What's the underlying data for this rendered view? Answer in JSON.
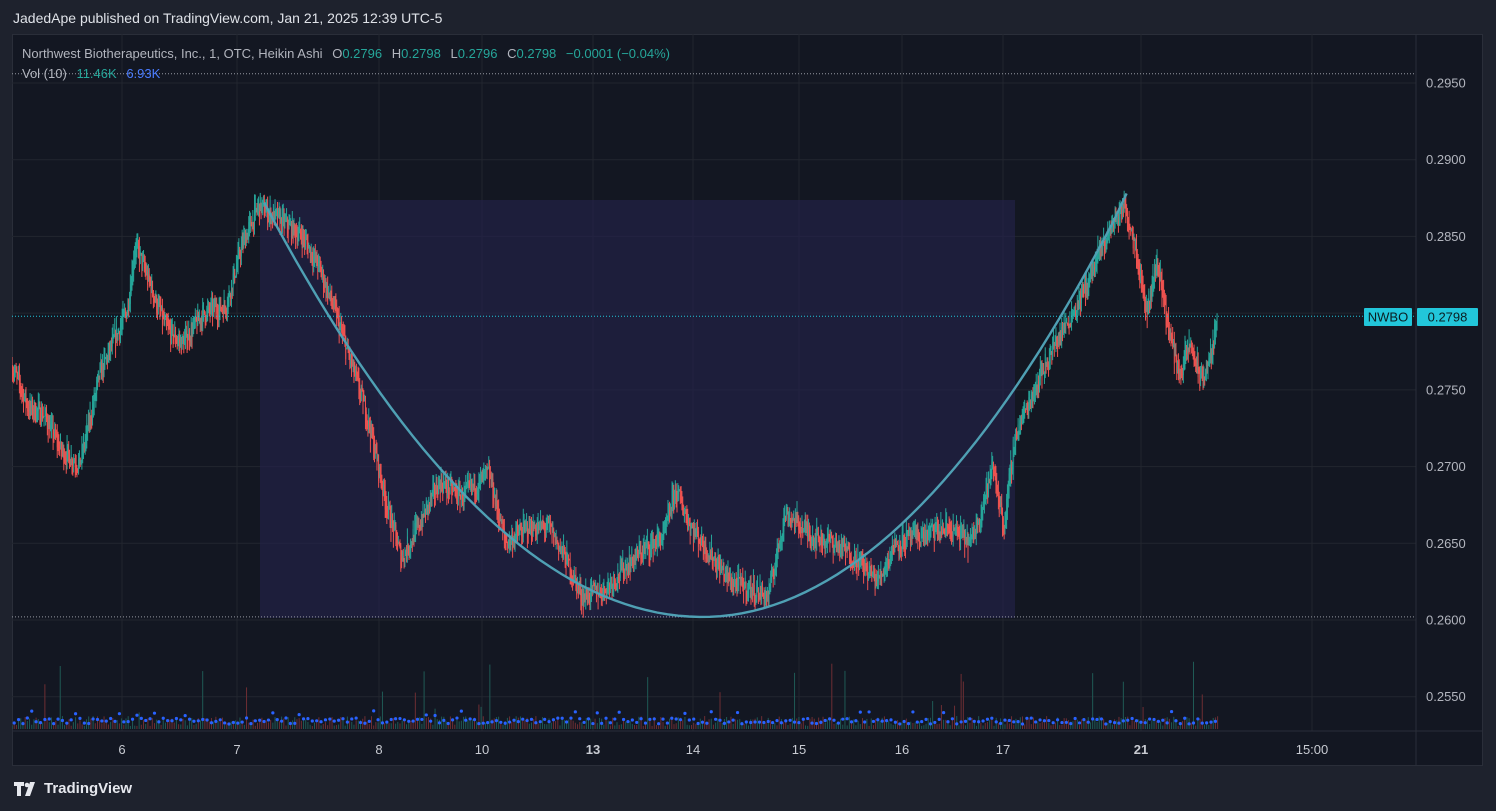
{
  "header": {
    "publisher_line": "JadedApe published on TradingView.com, Jan 21, 2025 12:39 UTC-5"
  },
  "legend": {
    "symbol_line": "Northwest Biotherapeutics, Inc., 1, OTC, Heikin Ashi",
    "o_label": "O",
    "o_value": "0.2796",
    "h_label": "H",
    "h_value": "0.2798",
    "l_label": "L",
    "l_value": "0.2796",
    "c_label": "C",
    "c_value": "0.2798",
    "change": "−0.0001 (−0.04%)",
    "vol_label": "Vol (10)",
    "vol_value": "11.46K",
    "vol_ma": "6.93K"
  },
  "price_tag": {
    "symbol": "NWBO",
    "value": "0.2798"
  },
  "footer": {
    "brand": "TradingView",
    "logo_icon": "tradingview-logo-icon"
  },
  "colors": {
    "up": "#26a69a",
    "down": "#ef5350",
    "accent": "#22c6da",
    "cup": "#4fa0b4",
    "volume_ma": "#2962ff",
    "zone": "#24224a"
  },
  "chart_data": {
    "type": "candlestick",
    "chart_style": "Heikin Ashi",
    "interval": "1",
    "y_axis": {
      "ticks": [
        "0.2950",
        "0.2900",
        "0.2850",
        "0.2800",
        "0.2750",
        "0.2700",
        "0.2650",
        "0.2600",
        "0.2550"
      ],
      "ylim": [
        0.2528,
        0.298
      ]
    },
    "x_axis": {
      "ticks": [
        "6",
        "7",
        "8",
        "10",
        "13",
        "14",
        "15",
        "16",
        "17",
        "21",
        "15:00"
      ],
      "bold_ticks": [
        "13",
        "21"
      ]
    },
    "last_price": 0.2798,
    "dotted_levels": [
      0.2956,
      0.2602
    ],
    "price_path": [
      {
        "t": 0.0,
        "p": 0.2765
      },
      {
        "t": 0.15,
        "p": 0.2738
      },
      {
        "t": 0.28,
        "p": 0.2735
      },
      {
        "t": 0.45,
        "p": 0.271
      },
      {
        "t": 0.62,
        "p": 0.2702
      },
      {
        "t": 0.8,
        "p": 0.276
      },
      {
        "t": 0.95,
        "p": 0.2785
      },
      {
        "t": 1.05,
        "p": 0.2802
      },
      {
        "t": 1.12,
        "p": 0.2845
      },
      {
        "t": 1.25,
        "p": 0.282
      },
      {
        "t": 1.4,
        "p": 0.279
      },
      {
        "t": 1.55,
        "p": 0.278
      },
      {
        "t": 1.75,
        "p": 0.28
      },
      {
        "t": 1.95,
        "p": 0.2805
      },
      {
        "t": 2.1,
        "p": 0.2845
      },
      {
        "t": 2.25,
        "p": 0.287
      },
      {
        "t": 2.45,
        "p": 0.286
      },
      {
        "t": 2.65,
        "p": 0.285
      },
      {
        "t": 2.8,
        "p": 0.283
      },
      {
        "t": 2.95,
        "p": 0.28
      },
      {
        "t": 3.1,
        "p": 0.2765
      },
      {
        "t": 3.25,
        "p": 0.273
      },
      {
        "t": 3.4,
        "p": 0.268
      },
      {
        "t": 3.55,
        "p": 0.264
      },
      {
        "t": 3.7,
        "p": 0.266
      },
      {
        "t": 3.9,
        "p": 0.269
      },
      {
        "t": 4.1,
        "p": 0.268
      },
      {
        "t": 4.35,
        "p": 0.2695
      },
      {
        "t": 4.5,
        "p": 0.265
      },
      {
        "t": 4.7,
        "p": 0.266
      },
      {
        "t": 4.9,
        "p": 0.266
      },
      {
        "t": 5.05,
        "p": 0.264
      },
      {
        "t": 5.2,
        "p": 0.2615
      },
      {
        "t": 5.4,
        "p": 0.262
      },
      {
        "t": 5.6,
        "p": 0.2635
      },
      {
        "t": 5.75,
        "p": 0.2645
      },
      {
        "t": 5.95,
        "p": 0.2655
      },
      {
        "t": 6.05,
        "p": 0.2685
      },
      {
        "t": 6.2,
        "p": 0.266
      },
      {
        "t": 6.4,
        "p": 0.264
      },
      {
        "t": 6.55,
        "p": 0.2625
      },
      {
        "t": 6.75,
        "p": 0.262
      },
      {
        "t": 6.9,
        "p": 0.2615
      },
      {
        "t": 7.05,
        "p": 0.267
      },
      {
        "t": 7.3,
        "p": 0.2655
      },
      {
        "t": 7.5,
        "p": 0.265
      },
      {
        "t": 7.7,
        "p": 0.264
      },
      {
        "t": 7.9,
        "p": 0.2625
      },
      {
        "t": 8.05,
        "p": 0.265
      },
      {
        "t": 8.3,
        "p": 0.2655
      },
      {
        "t": 8.55,
        "p": 0.266
      },
      {
        "t": 8.75,
        "p": 0.265
      },
      {
        "t": 8.95,
        "p": 0.27
      },
      {
        "t": 9.05,
        "p": 0.266
      },
      {
        "t": 9.15,
        "p": 0.272
      },
      {
        "t": 9.35,
        "p": 0.2755
      },
      {
        "t": 9.55,
        "p": 0.2785
      },
      {
        "t": 9.75,
        "p": 0.281
      },
      {
        "t": 9.9,
        "p": 0.2835
      },
      {
        "t": 10.05,
        "p": 0.286
      },
      {
        "t": 10.15,
        "p": 0.287
      },
      {
        "t": 10.25,
        "p": 0.2845
      },
      {
        "t": 10.35,
        "p": 0.28
      },
      {
        "t": 10.45,
        "p": 0.2835
      },
      {
        "t": 10.55,
        "p": 0.279
      },
      {
        "t": 10.65,
        "p": 0.276
      },
      {
        "t": 10.75,
        "p": 0.278
      },
      {
        "t": 10.85,
        "p": 0.2755
      },
      {
        "t": 10.95,
        "p": 0.2775
      },
      {
        "t": 11.0,
        "p": 0.2798
      }
    ]
  }
}
